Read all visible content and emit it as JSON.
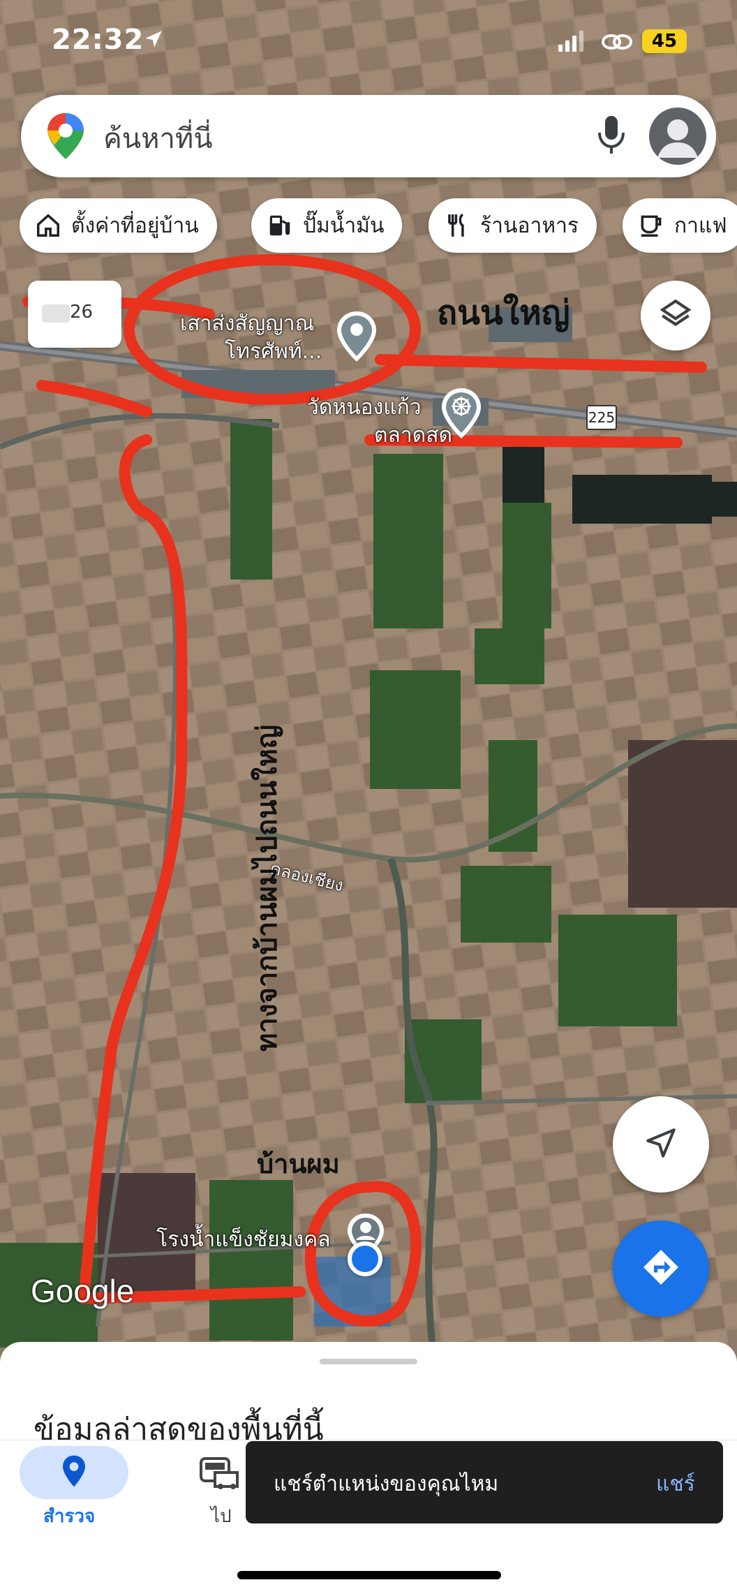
{
  "status_bar": {
    "time": "22:32",
    "battery": "45"
  },
  "search": {
    "placeholder": "ค้นหาที่นี่"
  },
  "chips": [
    {
      "label": "ตั้งค่าที่อยู่บ้าน",
      "icon": "home-icon"
    },
    {
      "label": "ปั๊มน้ำมัน",
      "icon": "gas-station-icon"
    },
    {
      "label": "ร้านอาหาร",
      "icon": "restaurant-icon"
    },
    {
      "label": "กาแฟ",
      "icon": "coffee-icon"
    }
  ],
  "map": {
    "weather_badge": "26",
    "places": {
      "tower": [
        "เสาส่งสัญญาณ",
        "โทรศัพท์..."
      ],
      "temple": [
        "วัดหนองแก้ว",
        "ตลาดสด"
      ],
      "canal": "คลองเชียง",
      "ice_factory": "โรงน้ำแข็งชัยมงคล"
    },
    "route_shield": "225",
    "annotations": {
      "main_road": "ถนนใหญ่",
      "route_text": "ทางจากบ้านผมไปถนนใหญ่",
      "my_house": "บ้านผม"
    },
    "google_logo": "Google",
    "annotation_color": "#e8321e",
    "location_dot_color": "#1a73e8"
  },
  "sheet": {
    "title": "ข้อมูลล่าสุดของพื้นที่นี้"
  },
  "navbar": {
    "explore_label": "สำรวจ",
    "go_label": "ไป"
  },
  "snackbar": {
    "message": "แชร์ตำแหน่งของคุณไหม",
    "action": "แชร์"
  }
}
